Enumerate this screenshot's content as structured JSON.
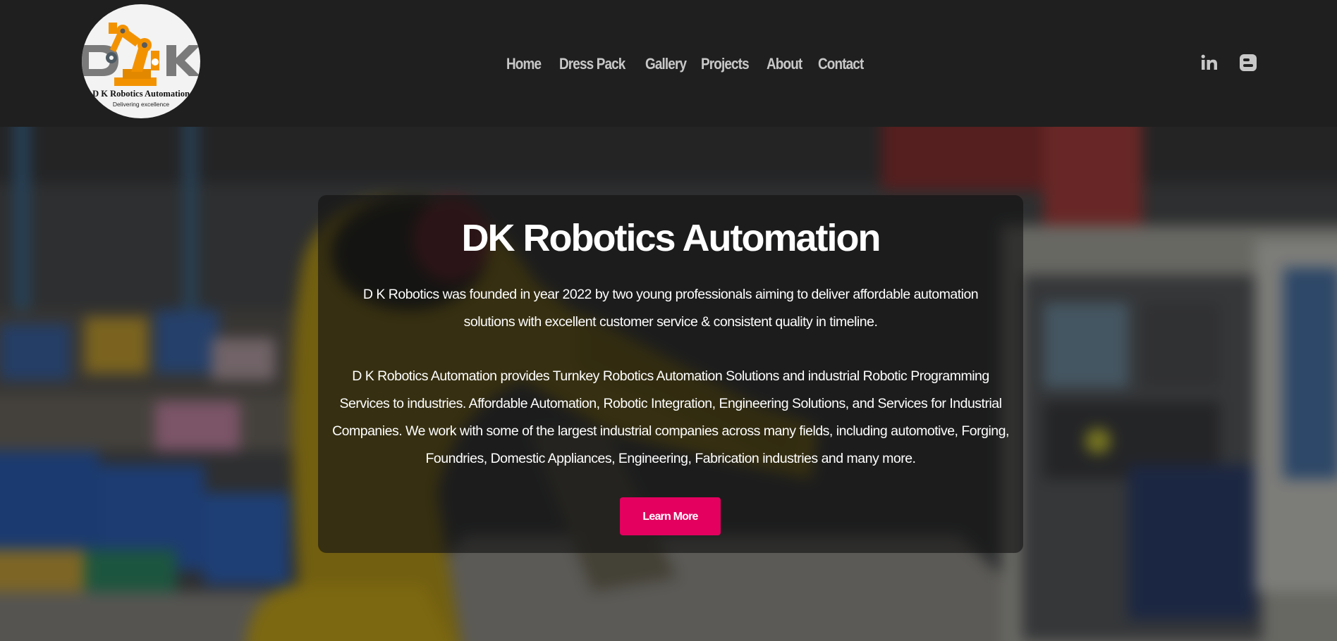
{
  "header": {
    "logo": {
      "name": "D K Robotics Automation",
      "tagline": "Delivering excellence",
      "colors": {
        "arm": "#f39200",
        "letters": "#7a7a7a",
        "background": "#f3f3f3"
      }
    },
    "nav": [
      {
        "label": "Home"
      },
      {
        "label": "Dress Pack"
      },
      {
        "label": "Gallery"
      },
      {
        "label": "Projects"
      },
      {
        "label": "About"
      },
      {
        "label": "Contact"
      }
    ],
    "social": [
      {
        "icon": "linkedin-icon"
      },
      {
        "icon": "blogger-icon"
      }
    ]
  },
  "hero": {
    "title": "DK Robotics Automation",
    "paragraph1": "D K Robotics was founded in year 2022 by two young professionals aiming to deliver affordable automation solutions with excellent customer service & consistent quality in timeline.",
    "paragraph2": "D K Robotics Automation provides Turnkey Robotics Automation Solutions and industrial Robotic Programming Services to industries. Affordable Automation, Robotic Integration, Engineering Solutions, and Services for Industrial Companies. We work with some of the largest industrial companies across many fields, including automotive, Forging, Foundries, Domestic Appliances, Engineering, Fabrication industries and many more.",
    "button_label": "Learn More"
  },
  "colors": {
    "header_bg": "#1f1f1f",
    "nav_text": "#c8c8c8",
    "accent": "#e3005f",
    "card_bg": "rgba(18,18,18,0.62)"
  }
}
